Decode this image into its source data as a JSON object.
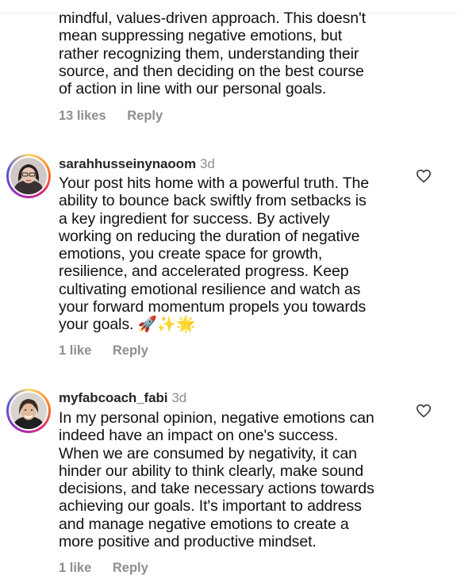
{
  "comments": [
    {
      "username": "",
      "time": "",
      "text": "mindful, values-driven approach. This doesn't\nmean suppressing negative emotions, but\nrather recognizing them, understanding their\nsource, and then deciding on the best course\nof action in line with our personal goals.",
      "likes": "13 likes",
      "reply": "Reply"
    },
    {
      "username": "sarahhusseinynaoom",
      "time": "3d",
      "text": "Your post hits home with a powerful truth. The\nability to bounce back swiftly from setbacks is\na key ingredient for success. By actively\nworking on reducing the duration of negative\nemotions, you create space for growth,\nresilience, and accelerated progress. Keep\ncultivating emotional resilience and watch as\nyour forward momentum propels you towards\nyour goals. 🚀✨🌟",
      "likes": "1 like",
      "reply": "Reply"
    },
    {
      "username": "myfabcoach_fabi",
      "time": "3d",
      "text": "In my personal opinion, negative emotions can\nindeed have an impact on one's success.\nWhen we are consumed by negativity, it can\nhinder our ability to think clearly, make sound\ndecisions, and take necessary actions towards\nachieving our goals. It's important to address\nand manage negative emotions to create a\nmore positive and productive mindset.",
      "likes": "1 like",
      "reply": "Reply"
    }
  ],
  "icons": {
    "like": "heart-outline-icon",
    "avatar_ring": "story-ring"
  },
  "colors": {
    "meta": "#8e8e8e",
    "text": "#111111"
  }
}
